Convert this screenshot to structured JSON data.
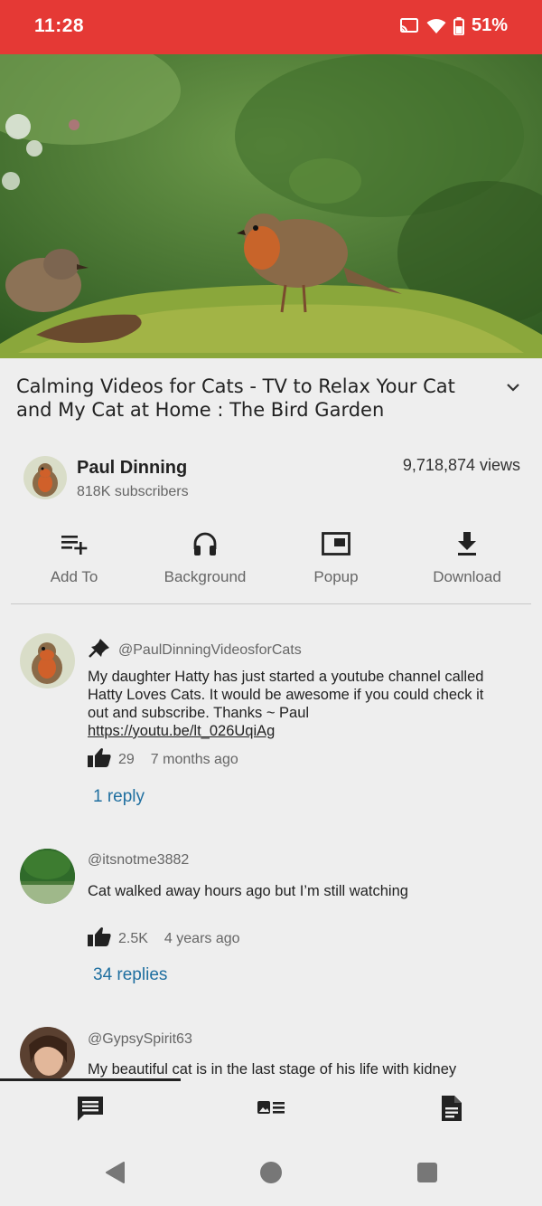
{
  "status": {
    "time": "11:28",
    "battery": "51%"
  },
  "video": {
    "title": "Calming Videos for Cats - TV to Relax Your Cat and My Cat at Home : The Bird Garden",
    "views": "9,718,874 views"
  },
  "channel": {
    "name": "Paul Dinning",
    "subscribers": "818K subscribers"
  },
  "actions": [
    {
      "label": "Add To",
      "icon": "playlist-add-icon"
    },
    {
      "label": "Background",
      "icon": "headphones-icon"
    },
    {
      "label": "Popup",
      "icon": "popup-icon"
    },
    {
      "label": "Download",
      "icon": "download-icon"
    }
  ],
  "comments": [
    {
      "pinned": true,
      "author": "@PaulDinningVideosforCats",
      "text": "My daughter Hatty has just started a youtube channel called Hatty Loves Cats. It would be awesome if you could check it out and subscribe. Thanks ~ Paul",
      "link": "https://youtu.be/lt_026UqiAg",
      "likes": "29",
      "time": "7 months ago",
      "replies": "1 reply"
    },
    {
      "author": "@itsnotme3882",
      "text": "Cat walked away hours ago but I’m still watching",
      "likes": "2.5K",
      "time": "4 years ago",
      "replies": "34 replies"
    },
    {
      "author": "@GypsySpirit63",
      "text": "My beautiful cat is in the last stage of his life with kidney"
    }
  ],
  "tabs": [
    {
      "icon": "comments-icon"
    },
    {
      "icon": "related-videos-icon"
    },
    {
      "icon": "description-icon"
    }
  ],
  "colors": {
    "status_bar": "#e53935",
    "link": "#1f6fa0",
    "background": "#eeeeee"
  }
}
